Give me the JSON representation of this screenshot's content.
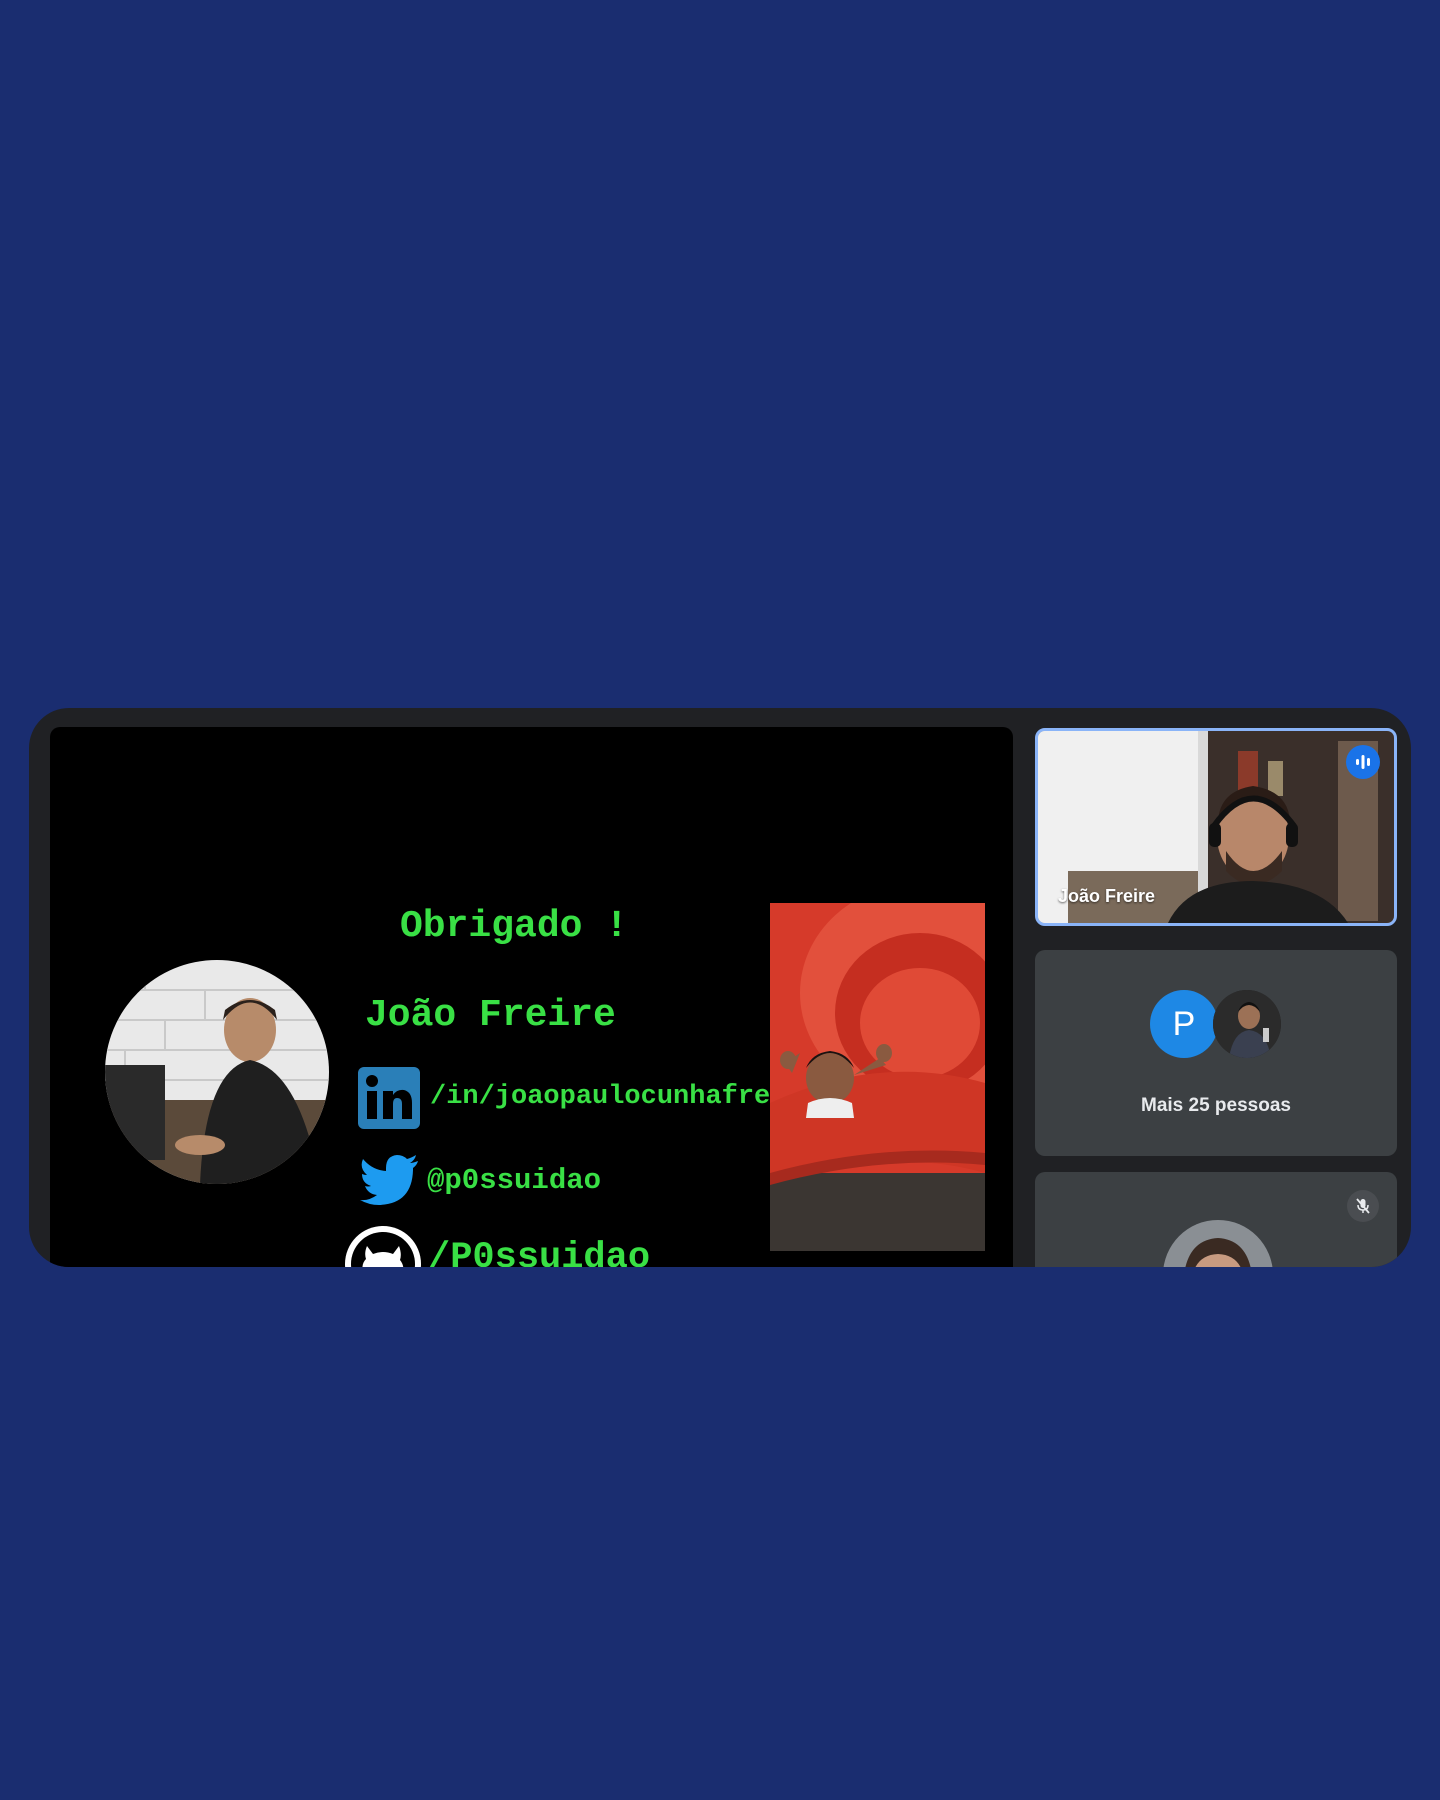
{
  "slide": {
    "title": "Obrigado !",
    "name": "João Freire",
    "linkedin": "/in/joaopaulocunhafreire",
    "twitter": "@p0ssuidao",
    "github": "/P0ssuidao"
  },
  "participants": {
    "active_speaker": {
      "name": "João Freire",
      "icon": "speaking-icon"
    },
    "more_tile": {
      "avatar_letter": "P",
      "label": "Mais 25 pessoas"
    },
    "third_tile": {
      "icon": "mic-off-icon"
    }
  },
  "colors": {
    "page_background": "#1a2d70",
    "call_background": "#202124",
    "slide_text": "#39e045",
    "active_border": "#8ab4f8",
    "avatar_p": "#1e88e5"
  }
}
